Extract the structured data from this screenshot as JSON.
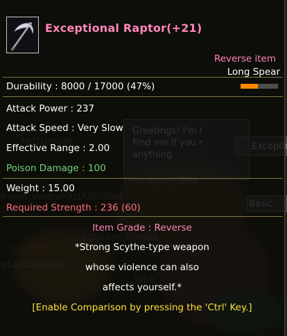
{
  "item": {
    "name": "Exceptional Raptor(+21)",
    "grade_tag": "Reverse item",
    "type": "Long Spear",
    "durability_text": "Durability : 8000 / 17000 (47%)",
    "durability_fraction": 0.47,
    "attack_power": "Attack Power : 237",
    "attack_speed": "Attack Speed : Very Slow",
    "effective_range": "Effective Range : 2.00",
    "poison_damage": "Poison Damage : 100",
    "weight": "Weight : 15.00",
    "required_strength": "Required Strength : 236 (60)",
    "item_grade": "Item Grade : Reverse",
    "description": [
      "*Strong Scythe-type weapon",
      "whose violence can also",
      "affects yourself.*"
    ],
    "compare_hint": "[Enable Comparison by pressing the 'Ctrl' Key.]",
    "icon": "scythe-icon"
  },
  "background": {
    "greeting_lines": [
      "Greetings! I'm l",
      "Find me if you r",
      "anything."
    ],
    "button_exceptional": "Exceptio",
    "button_basic": "Basic",
    "ghost_names": [
      "MUTLUYUM",
      "[Manager]~Billb",
      "rdream_Veteran]IzUUUUUmt",
      "[Chicken]Bomba",
      "[QUEBEC]",
      "reLastLifeSaver",
      "Whe"
    ]
  },
  "colors": {
    "title": "#ff87b8",
    "bonus": "#74d37c",
    "requirement": "#ff6f7d",
    "hint": "#ffe23a",
    "durability_bar": "#ff8a00"
  }
}
